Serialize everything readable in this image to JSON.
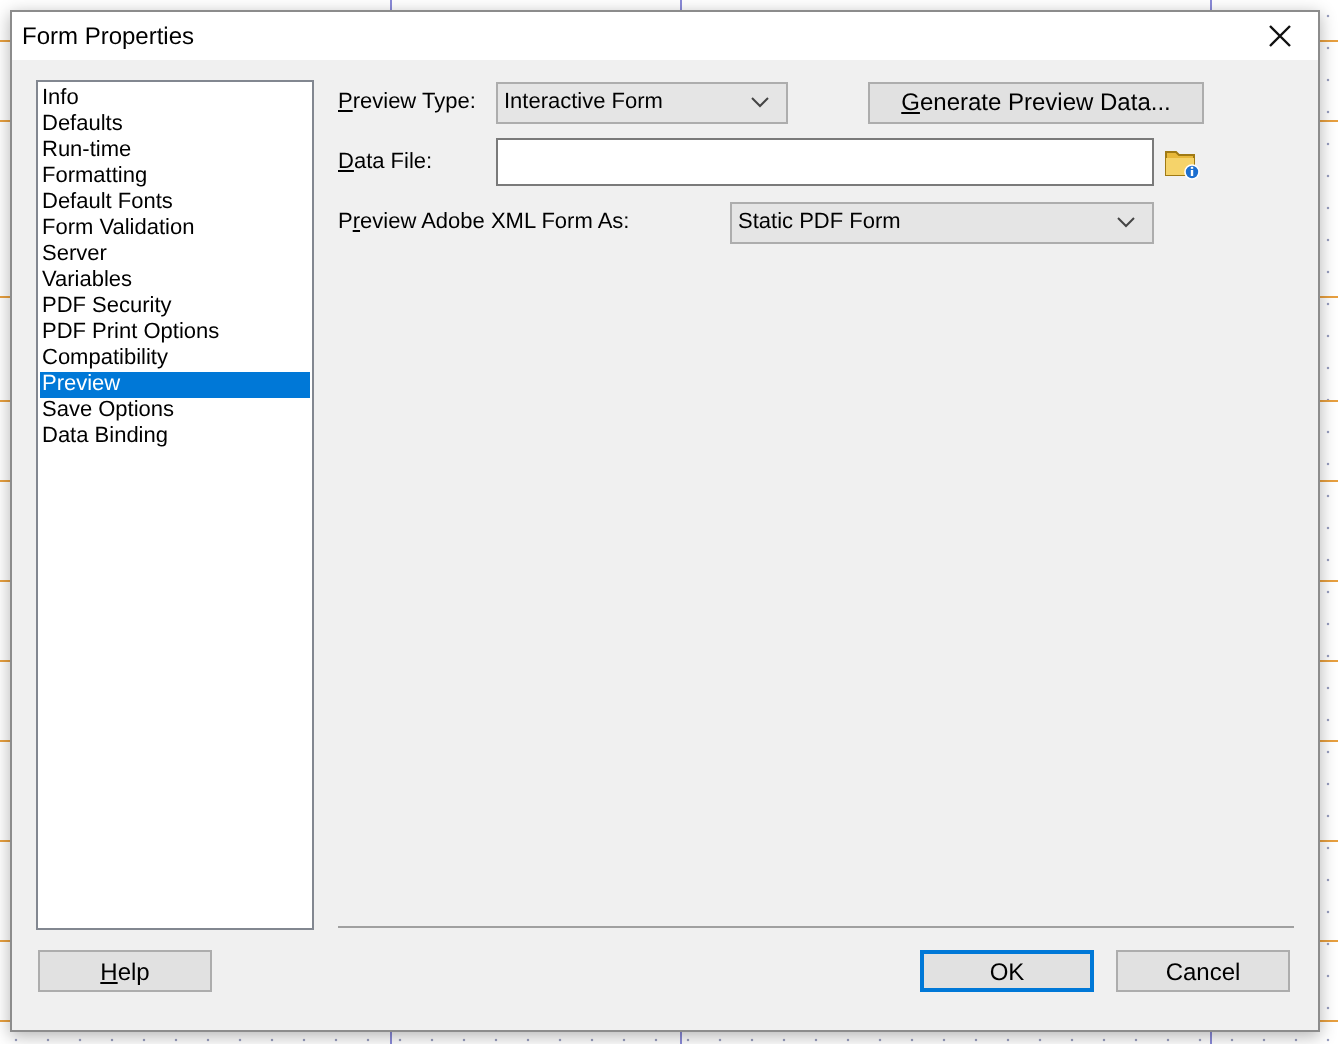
{
  "window": {
    "title": "Form Properties"
  },
  "sidebar": {
    "items": [
      {
        "label": "Info",
        "selected": false
      },
      {
        "label": "Defaults",
        "selected": false
      },
      {
        "label": "Run-time",
        "selected": false
      },
      {
        "label": "Formatting",
        "selected": false
      },
      {
        "label": "Default Fonts",
        "selected": false
      },
      {
        "label": "Form Validation",
        "selected": false
      },
      {
        "label": "Server",
        "selected": false
      },
      {
        "label": "Variables",
        "selected": false
      },
      {
        "label": "PDF Security",
        "selected": false
      },
      {
        "label": "PDF Print Options",
        "selected": false
      },
      {
        "label": "Compatibility",
        "selected": false
      },
      {
        "label": "Preview",
        "selected": true
      },
      {
        "label": "Save Options",
        "selected": false
      },
      {
        "label": "Data Binding",
        "selected": false
      }
    ]
  },
  "preview_type": {
    "access_key": "P",
    "label_rest": "review Type:",
    "value": "Interactive Form"
  },
  "generate_button": {
    "access_key": "G",
    "label_rest": "enerate Preview Data..."
  },
  "data_file": {
    "access_key": "D",
    "label_rest": "ata File:"
  },
  "preview_as": {
    "label_start": "P",
    "access_key": "r",
    "label_rest": "eview Adobe XML Form As:",
    "value": "Static PDF Form"
  },
  "buttons": [
    {
      "access_key": "H",
      "label_rest": "elp",
      "default": false
    },
    {
      "label_rest": "OK",
      "default": true
    },
    {
      "label_rest": "Cancel",
      "default": false
    }
  ]
}
